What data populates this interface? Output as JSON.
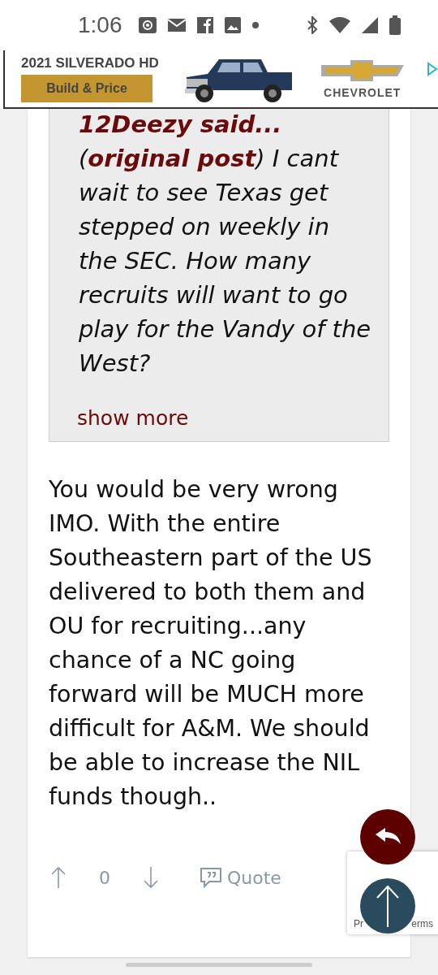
{
  "status_bar": {
    "time": "1:06"
  },
  "ad": {
    "headline": "2021 SILVERADO HD",
    "button": "Build & Price",
    "brand": "CHEVROLET"
  },
  "quote": {
    "author": "12Deezy said...",
    "text": "(**original post**) I cant wait to see Texas get stepped on weekly in the SEC. How many recruits will want to go play for the Vandy of the West?",
    "show_more": "show more"
  },
  "post": {
    "body": "You would be very wrong IMO. With the entire Southeastern part of the US delivered to both them and OU for recruiting...any chance of a NC going forward will be MUCH more difficult for A&M. We should be able to increase the NIL funds though..",
    "votes": "0",
    "quote_button": "Quote"
  },
  "recaptcha": {
    "privacy": "Pr",
    "terms": "erms"
  }
}
